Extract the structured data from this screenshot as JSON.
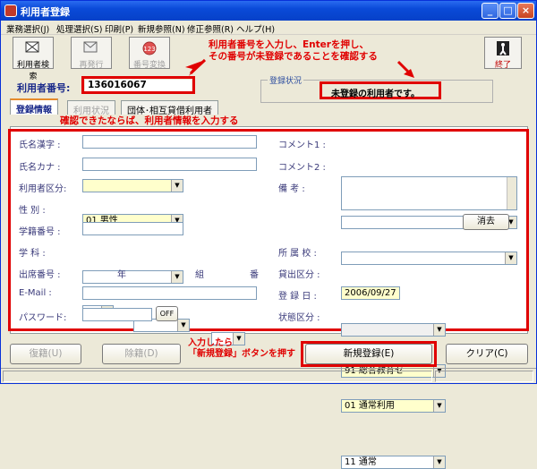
{
  "window": {
    "title": "利用者登録",
    "minimize": "_",
    "maximize": "□",
    "close": "×"
  },
  "menu": [
    "業務選択(J)",
    "処理選択(S)",
    "印刷(P)",
    "新規参照(N)",
    "修正参照(R)",
    "ヘルプ(H)"
  ],
  "toolbar": {
    "search": "利用者検索",
    "reissue": "再発行",
    "number_change": "番号変換",
    "exit": "終了"
  },
  "annotations": {
    "top": "利用者番号を入力し、Enterを押し、\nその番号が未登録であることを確認する",
    "middle": "確認できたならば、利用者情報を入力する",
    "bottom": "入力したら\n「新規登録」ボタンを押す"
  },
  "user_number": {
    "label": "利用者番号:",
    "value": "136016067"
  },
  "registration_status": {
    "legend": "登録状況",
    "value": "未登録の利用者です。"
  },
  "tabs": [
    "登録情報",
    "利用状況",
    "団体･相互貸借利用者"
  ],
  "form": {
    "kanji_name": {
      "label": "氏名漢字 :",
      "value": ""
    },
    "kana_name": {
      "label": "氏名カナ :",
      "value": ""
    },
    "user_category": {
      "label": "利用者区分:",
      "value": ""
    },
    "gender": {
      "label": "性 別 :",
      "value": "01 男性"
    },
    "student_number": {
      "label": "学籍番号 :",
      "value": ""
    },
    "department": {
      "label": "学 科 :",
      "value": ""
    },
    "attendance_number": {
      "label": "出席番号 :",
      "year_label": "年",
      "class_label": "組",
      "number_label": "番"
    },
    "email": {
      "label": "E-Mail :",
      "value": ""
    },
    "password": {
      "label": "パスワード:",
      "value": "",
      "toggle": "OFF"
    },
    "comment1": {
      "label": "コメント1 :",
      "value": ""
    },
    "comment2": {
      "label": "コメント2 :",
      "value": ""
    },
    "remarks": {
      "label": "備 考 :",
      "value": "",
      "clear": "消去"
    },
    "school": {
      "label": "所 属 校 :",
      "value": "91 総合教育セ"
    },
    "lending_category": {
      "label": "貸出区分 :",
      "value": "01 通常利用"
    },
    "registration_date": {
      "label": "登 録 日 :",
      "value": "2006/09/27"
    },
    "status_category": {
      "label": "状態区分 :",
      "value": "11 通常"
    }
  },
  "buttons": {
    "readmit": "復籍(U)",
    "expel": "除籍(D)",
    "new_register": "新規登録(E)",
    "clear": "クリア(C)"
  }
}
